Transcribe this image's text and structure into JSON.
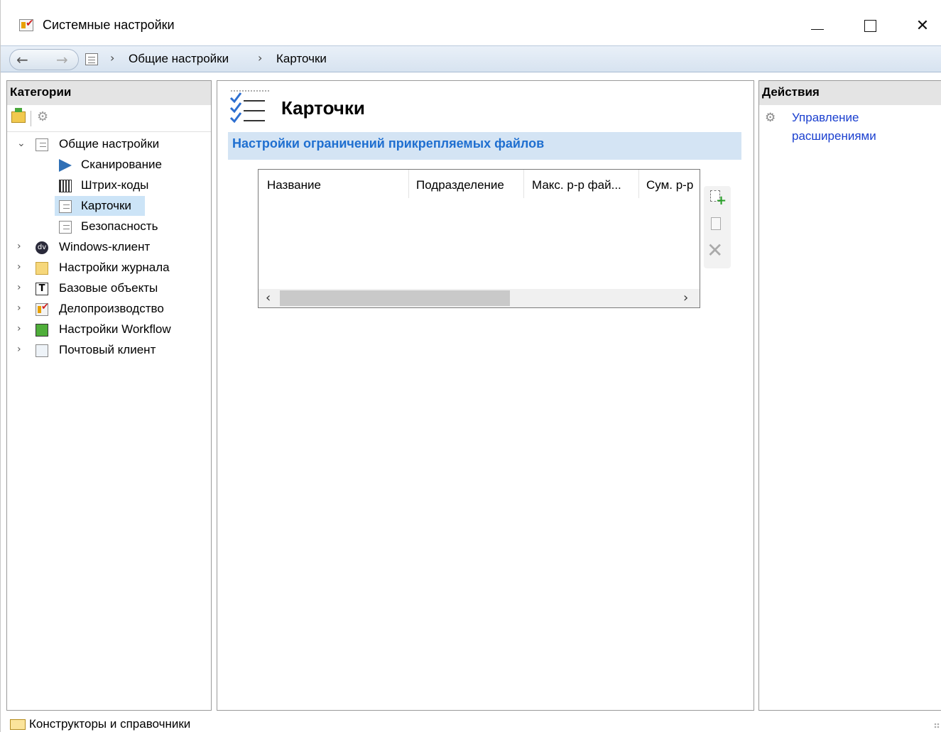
{
  "window": {
    "title": "Системные настройки",
    "icon": "app-settings-icon",
    "controls": {
      "minimize": "minimize",
      "maximize": "maximize",
      "close": "close"
    }
  },
  "navbar": {
    "back_icon": "back-arrow-icon",
    "forward_icon": "forward-arrow-icon",
    "breadcrumbs": [
      "Общие настройки",
      "Карточки"
    ]
  },
  "categories": {
    "header": "Категории",
    "toolbar": {
      "new_icon": "folder-add-icon",
      "extensions_icon": "gears-icon"
    },
    "tree": [
      {
        "label": "Общие настройки",
        "expanded": true,
        "icon": "list-icon"
      },
      {
        "label": "Сканирование",
        "icon": "scanner-icon"
      },
      {
        "label": "Штрих-коды",
        "icon": "barcode-icon"
      },
      {
        "label": "Карточки",
        "icon": "list-icon",
        "selected": true
      },
      {
        "label": "Безопасность",
        "icon": "list-icon"
      },
      {
        "label": "Windows-клиент",
        "icon": "dv-icon"
      },
      {
        "label": "Настройки журнала",
        "icon": "folder-icon"
      },
      {
        "label": "Базовые объекты",
        "icon": "t-icon"
      },
      {
        "label": "Делопроизводство",
        "icon": "delo-icon"
      },
      {
        "label": "Настройки Workflow",
        "icon": "workflow-icon"
      },
      {
        "label": "Почтовый клиент",
        "icon": "mail-icon"
      }
    ]
  },
  "main": {
    "title": "Карточки",
    "section_title": "Настройки ограничений прикрепляемых файлов",
    "grid": {
      "columns": [
        "Название",
        "Подразделение",
        "Макс. р-р фай...",
        "Сум. р-р"
      ],
      "rows": []
    },
    "tools": {
      "add_icon": "add-row-icon",
      "edit_icon": "edit-row-icon",
      "delete_icon": "delete-icon"
    }
  },
  "actions": {
    "header": "Действия",
    "items": [
      {
        "label": "Управление расширениями",
        "icon": "gears-icon"
      }
    ]
  },
  "statusbar": {
    "text": "Конструкторы и справочники",
    "icon": "folder-open-icon"
  },
  "colors": {
    "accent": "#1f6fd0",
    "link": "#1a3fcf",
    "selection": "#cce4f7",
    "section_bg": "#d4e4f4"
  }
}
